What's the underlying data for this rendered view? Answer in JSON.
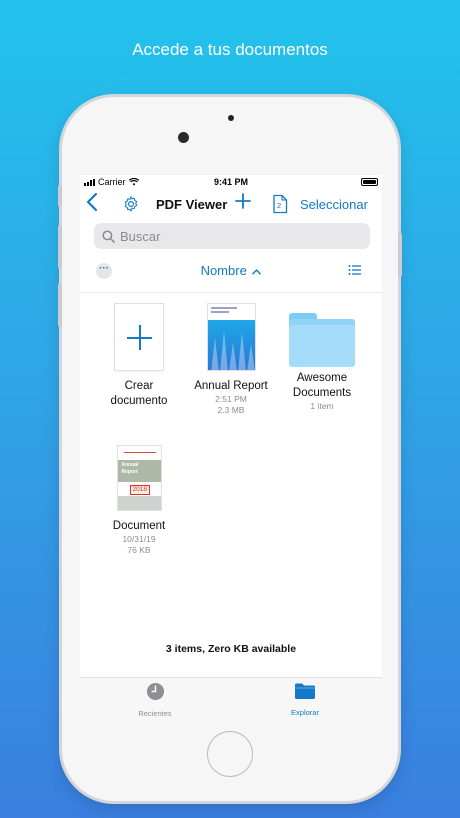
{
  "headline": "Accede a tus documentos",
  "status_bar": {
    "carrier": "Carrier",
    "time": "9:41 PM"
  },
  "nav": {
    "back_icon": "chevron-left-icon",
    "settings_icon": "gear-icon",
    "title": "PDF Viewer",
    "add_icon": "plus-icon",
    "tabs_icon": "tabs-icon",
    "tabs_count": "2",
    "select_label": "Seleccionar"
  },
  "search": {
    "placeholder": "Buscar"
  },
  "sort": {
    "label": "Nombre",
    "more_icon": "ellipsis-icon",
    "list_icon": "list-view-icon"
  },
  "items": [
    {
      "name_line1": "Crear",
      "name_line2": "documento",
      "type": "create"
    },
    {
      "name": "Annual Report",
      "meta1": "2:51 PM",
      "meta2": "2.3 MB",
      "type": "pdf"
    },
    {
      "name_line1": "Awesome",
      "name_line2": "Documents",
      "meta1": "1 item",
      "type": "folder"
    },
    {
      "name": "Document",
      "meta1": "10/31/19",
      "meta2": "76 KB",
      "type": "pdf",
      "thumb_text1": "Annual",
      "thumb_text2": "Report",
      "thumb_year": "2018"
    }
  ],
  "storage_status": "3 items, Zero KB available",
  "tabbar": {
    "items": [
      {
        "label": "Recientes",
        "icon": "clock-icon",
        "active": false
      },
      {
        "label": "Explorar",
        "icon": "folder-icon",
        "active": true
      }
    ]
  },
  "colors": {
    "accent": "#1479c9",
    "inactive": "#8e8e93"
  }
}
